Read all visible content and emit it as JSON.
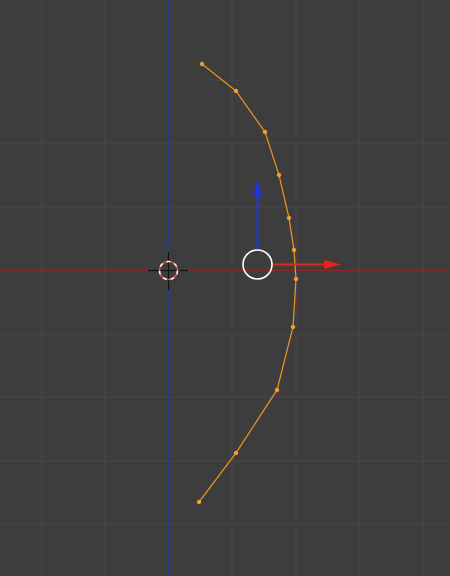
{
  "viewport": {
    "view": "front-orthographic",
    "mode": "edit-mode",
    "background_color": "#3d3d3d",
    "grid_color": "#474747",
    "axis_x_color": "#8c2a2a",
    "axis_z_color": "#2a3a8c"
  },
  "curve": {
    "type": "poly-curve",
    "color": "#f2941f",
    "vertex_color": "#f29d2e",
    "vertex_count": 12,
    "selected": true
  },
  "cursor_3d": {
    "icon": "3d-cursor-icon",
    "ring_colors": [
      "#ffffff",
      "#e64a3c"
    ]
  },
  "manipulator": {
    "icon": "translate-manipulator-icon",
    "center_color": "#ffffff",
    "x_arrow_color": "#e8231c",
    "z_arrow_color": "#1d36e0",
    "axes_shown": [
      "x",
      "z"
    ]
  }
}
